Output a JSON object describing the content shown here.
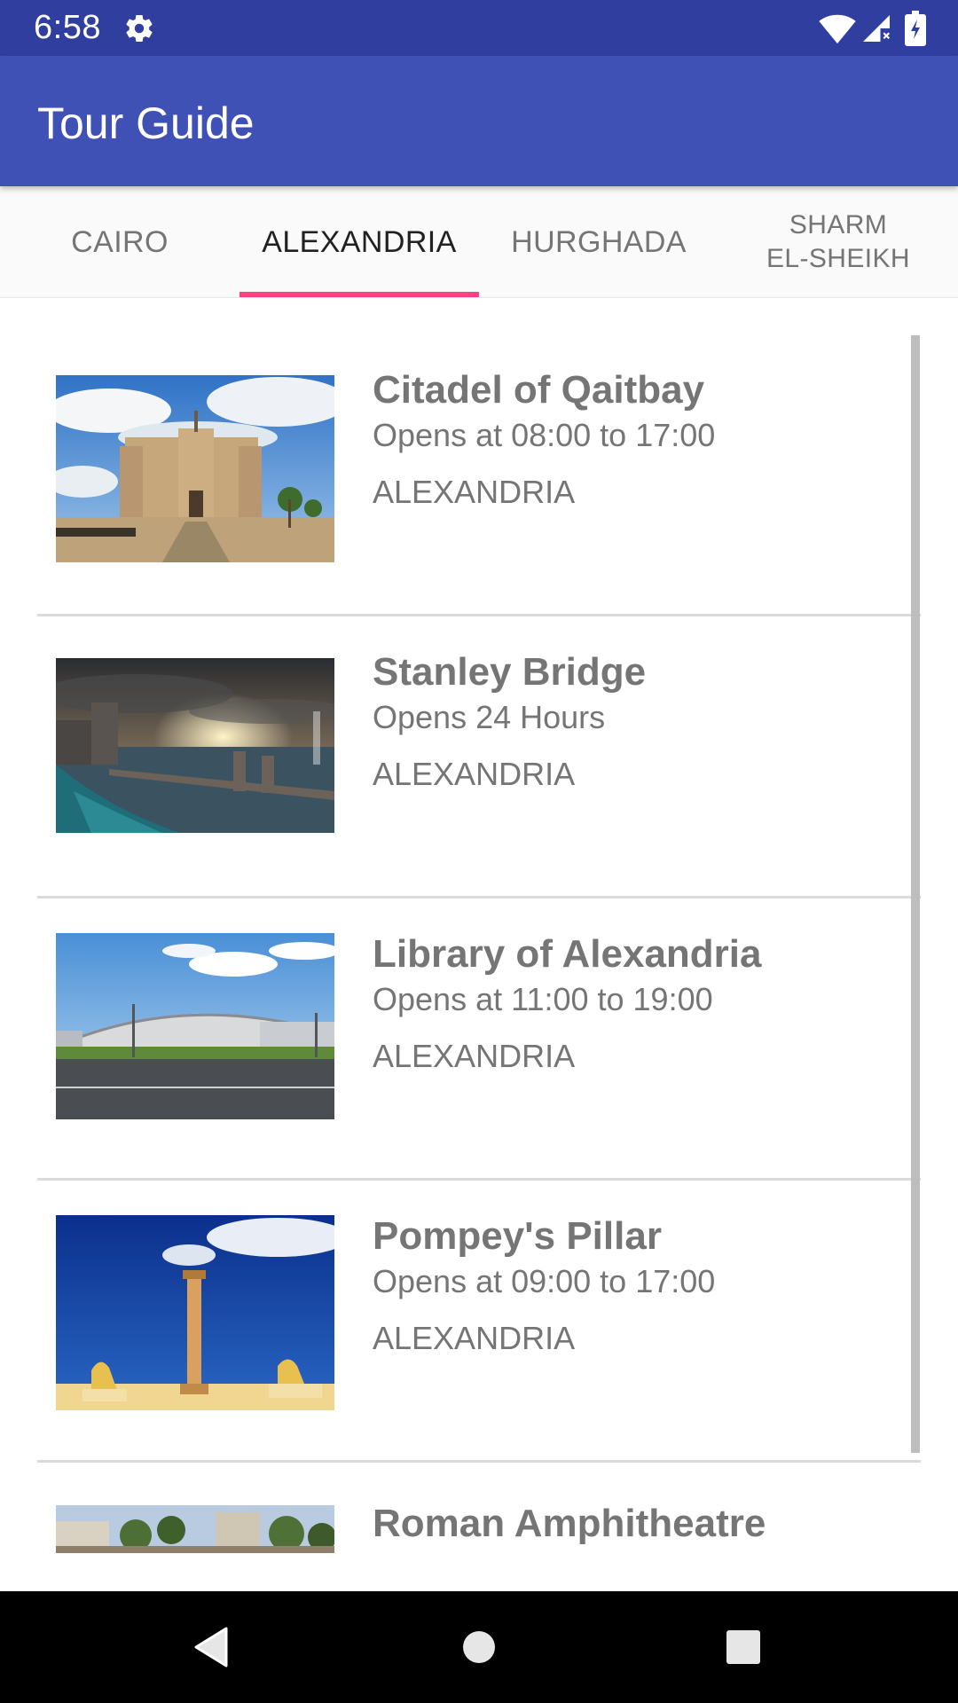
{
  "status_bar": {
    "time": "6:58",
    "icons": [
      "gear-icon",
      "wifi-icon",
      "cell-signal-icon",
      "battery-charging-icon"
    ]
  },
  "app_bar": {
    "title": "Tour Guide"
  },
  "tabs": [
    {
      "label": "CAIRO",
      "active": false
    },
    {
      "label": "ALEXANDRIA",
      "active": true
    },
    {
      "label": "HURGHADA",
      "active": false
    },
    {
      "label": "SHARM\nEL-SHEIKH",
      "active": false
    }
  ],
  "places": [
    {
      "name": "Citadel of Qaitbay",
      "hours": "Opens at 08:00 to 17:00",
      "city": "ALEXANDRIA",
      "image": "citadel-photo"
    },
    {
      "name": "Stanley Bridge",
      "hours": "Opens 24 Hours",
      "city": "ALEXANDRIA",
      "image": "bridge-photo"
    },
    {
      "name": "Library of Alexandria",
      "hours": "Opens at 11:00 to 19:00",
      "city": "ALEXANDRIA",
      "image": "library-photo"
    },
    {
      "name": "Pompey's Pillar",
      "hours": "Opens at 09:00 to 17:00",
      "city": "ALEXANDRIA",
      "image": "pillar-photo"
    },
    {
      "name": "Roman Amphitheatre",
      "hours": "",
      "city": "",
      "image": "amphitheatre-photo"
    }
  ],
  "colors": {
    "status_bar": "#303F9F",
    "app_bar": "#3F51B5",
    "tab_indicator": "#FF4081",
    "tab_text": "#757575",
    "tab_text_active": "#212121",
    "item_text": "#757575"
  },
  "nav_bar": {
    "icons": [
      "back-icon",
      "home-icon",
      "recents-icon"
    ]
  }
}
